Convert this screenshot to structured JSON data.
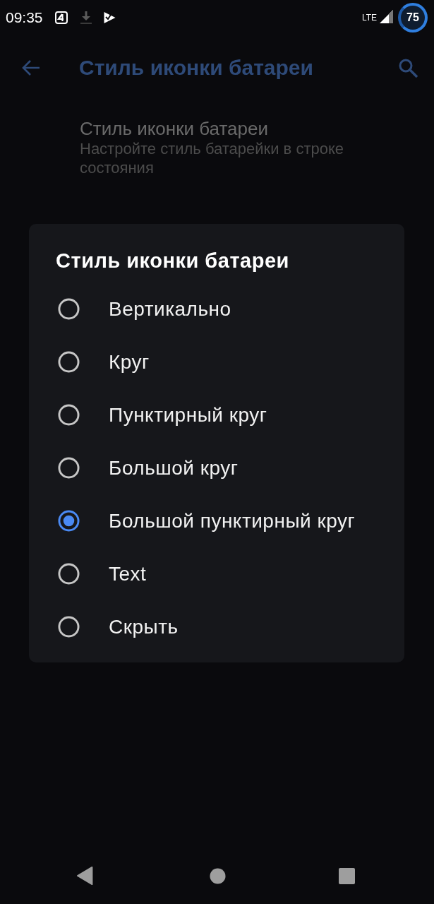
{
  "status_bar": {
    "time": "09:35",
    "network": "LTE",
    "battery": "75"
  },
  "app_bar": {
    "title": "Стиль иконки батареи"
  },
  "settings": [
    {
      "title": "Стиль иконки батареи",
      "summary": "Настройте стиль батарейки в строке состояния"
    }
  ],
  "dialog": {
    "title": "Стиль иконки батареи",
    "options": [
      {
        "label": "Вертикально",
        "selected": false
      },
      {
        "label": "Круг",
        "selected": false
      },
      {
        "label": "Пунктирный круг",
        "selected": false
      },
      {
        "label": "Большой круг",
        "selected": false
      },
      {
        "label": "Большой пунктирный круг",
        "selected": true
      },
      {
        "label": "Text",
        "selected": false
      },
      {
        "label": "Скрыть",
        "selected": false
      }
    ]
  }
}
